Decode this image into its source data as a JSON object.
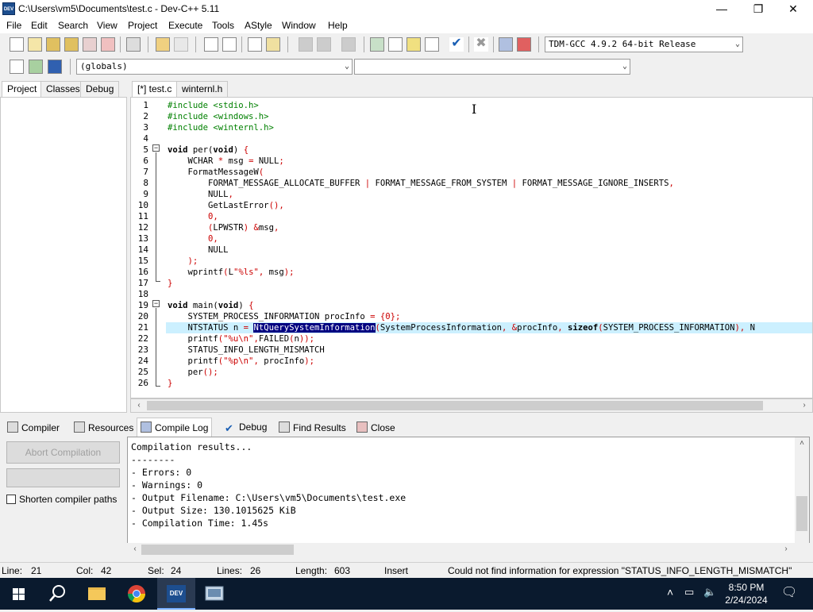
{
  "window": {
    "title": "C:\\Users\\vm5\\Documents\\test.c - Dev-C++ 5.11",
    "icon_label": "DEV",
    "min_glyph": "—",
    "max_glyph": "❐",
    "close_glyph": "✕"
  },
  "menu": [
    "File",
    "Edit",
    "Search",
    "View",
    "Project",
    "Execute",
    "Tools",
    "AStyle",
    "Window",
    "Help"
  ],
  "toolbar": {
    "compiler_select": "TDM-GCC 4.9.2 64-bit Release",
    "scope_select": "(globals)",
    "member_select": ""
  },
  "left_tabs": [
    "Project",
    "Classes",
    "Debug"
  ],
  "editor_tabs": [
    "[*] test.c",
    "winternl.h"
  ],
  "code_lines": [
    {
      "n": "1",
      "html": "<span class=\"pp\">#include &lt;stdio.h&gt;</span>"
    },
    {
      "n": "2",
      "html": "<span class=\"pp\">#include &lt;windows.h&gt;</span>"
    },
    {
      "n": "3",
      "html": "<span class=\"pp\">#include &lt;winternl.h&gt;</span>"
    },
    {
      "n": "4",
      "html": ""
    },
    {
      "n": "5",
      "html": "<span class=\"kw\">void</span> per(<span class=\"kw\">void</span>) <span class=\"sym\">{</span>"
    },
    {
      "n": "6",
      "html": "    WCHAR <span class=\"sym\">*</span> msg <span class=\"sym\">=</span> NULL<span class=\"sym\">;</span>"
    },
    {
      "n": "7",
      "html": "    FormatMessageW<span class=\"sym\">(</span>"
    },
    {
      "n": "8",
      "html": "        FORMAT_MESSAGE_ALLOCATE_BUFFER <span class=\"sym\">|</span> FORMAT_MESSAGE_FROM_SYSTEM <span class=\"sym\">|</span> FORMAT_MESSAGE_IGNORE_INSERTS<span class=\"sym\">,</span>"
    },
    {
      "n": "9",
      "html": "        NULL<span class=\"sym\">,</span>"
    },
    {
      "n": "10",
      "html": "        GetLastError<span class=\"sym\">(),</span>"
    },
    {
      "n": "11",
      "html": "        <span class=\"sym\">0,</span>"
    },
    {
      "n": "12",
      "html": "        <span class=\"sym\">(</span>LPWSTR<span class=\"sym\">)</span> <span class=\"sym\">&amp;</span>msg<span class=\"sym\">,</span>"
    },
    {
      "n": "13",
      "html": "        <span class=\"sym\">0,</span>"
    },
    {
      "n": "14",
      "html": "        NULL"
    },
    {
      "n": "15",
      "html": "    <span class=\"sym\">);</span>"
    },
    {
      "n": "16",
      "html": "    wprintf<span class=\"sym\">(</span>L<span class=\"str\">\"%ls\"</span><span class=\"sym\">,</span> msg<span class=\"sym\">);</span>"
    },
    {
      "n": "17",
      "html": "<span class=\"sym\">}</span>"
    },
    {
      "n": "18",
      "html": ""
    },
    {
      "n": "19",
      "html": "<span class=\"kw\">void</span> main(<span class=\"kw\">void</span>) <span class=\"sym\">{</span>"
    },
    {
      "n": "20",
      "html": "    SYSTEM_PROCESS_INFORMATION procInfo <span class=\"sym\">=</span> <span class=\"sym\">{0};</span>"
    },
    {
      "n": "21",
      "html": "    NTSTATUS n <span class=\"sym\">=</span> <span class=\"sel\">NtQuerySystemInformation</span><span class=\"sym\">(</span>SystemProcessInformation<span class=\"sym\">,</span> <span class=\"sym\">&amp;</span>procInfo<span class=\"sym\">,</span> <span class=\"kw\">sizeof</span><span class=\"sym\">(</span>SYSTEM_PROCESS_INFORMATION<span class=\"sym\">),</span> N"
    },
    {
      "n": "22",
      "html": "    printf<span class=\"sym\">(</span><span class=\"str\">\"%u\\n\"</span><span class=\"sym\">,</span>FAILED<span class=\"sym\">(</span>n<span class=\"sym\">));</span>"
    },
    {
      "n": "23",
      "html": "    STATUS_INFO_LENGTH_MISMATCH"
    },
    {
      "n": "24",
      "html": "    printf<span class=\"sym\">(</span><span class=\"str\">\"%p\\n\"</span><span class=\"sym\">,</span> procInfo<span class=\"sym\">);</span>"
    },
    {
      "n": "25",
      "html": "    per<span class=\"sym\">();</span>"
    },
    {
      "n": "26",
      "html": "<span class=\"sym\">}</span>"
    }
  ],
  "bottom_tabs": [
    "Compiler",
    "Resources",
    "Compile Log",
    "Debug",
    "Find Results",
    "Close"
  ],
  "bottom_left": {
    "abort_button": "Abort Compilation",
    "shorten_label": "Shorten compiler paths"
  },
  "log_lines": [
    "Compilation results...",
    "--------",
    "- Errors: 0",
    "- Warnings: 0",
    "- Output Filename: C:\\Users\\vm5\\Documents\\test.exe",
    "- Output Size: 130.1015625 KiB",
    "- Compilation Time: 1.45s"
  ],
  "status": {
    "line_label": "Line:",
    "line_value": "21",
    "col_label": "Col:",
    "col_value": "42",
    "sel_label": "Sel:",
    "sel_value": "24",
    "lines_label": "Lines:",
    "lines_value": "26",
    "length_label": "Length:",
    "length_value": "603",
    "mode": "Insert",
    "message": "Could not find information for expression \"STATUS_INFO_LENGTH_MISMATCH\""
  },
  "taskbar": {
    "time": "8:50 PM",
    "date": "2/24/2024",
    "devcpp_label": "DEV"
  }
}
